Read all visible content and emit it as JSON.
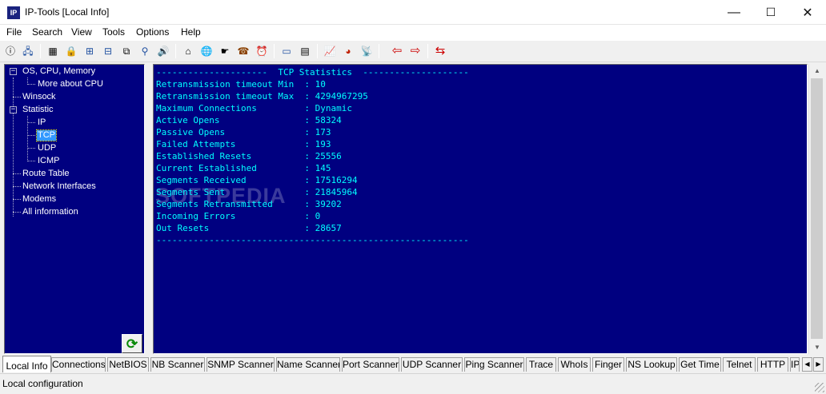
{
  "window": {
    "title": "IP-Tools [Local Info]",
    "icon_text": "IP",
    "controls": {
      "minimize": "—",
      "maximize": "☐",
      "close": "✕"
    }
  },
  "menu": [
    "File",
    "Search",
    "View",
    "Tools",
    "Options",
    "Help"
  ],
  "toolbar": {
    "buttons": [
      {
        "icon": "info-icon",
        "glyph": "ⓘ"
      },
      {
        "icon": "computers-icon",
        "glyph": "🖧"
      },
      {
        "icon": "table-icon",
        "glyph": "▦"
      },
      {
        "icon": "lock-icon",
        "glyph": "🔒"
      },
      {
        "icon": "network-tree-icon",
        "glyph": "⊞"
      },
      {
        "icon": "hierarchy-icon",
        "glyph": "⊟"
      },
      {
        "icon": "binoculars-icon",
        "glyph": "⧉"
      },
      {
        "icon": "ping-icon",
        "glyph": "⚲"
      },
      {
        "icon": "speaker-icon",
        "glyph": "🔊"
      },
      {
        "icon": "hub-icon",
        "glyph": "⌂"
      },
      {
        "icon": "globe-icon",
        "glyph": "🌐"
      },
      {
        "icon": "finger-icon",
        "glyph": "☛"
      },
      {
        "icon": "phone-icon",
        "glyph": "☎"
      },
      {
        "icon": "clock-icon",
        "glyph": "⏰"
      },
      {
        "icon": "telnet-icon",
        "glyph": "▭"
      },
      {
        "icon": "document-icon",
        "glyph": "▤"
      },
      {
        "icon": "chart-icon",
        "glyph": "📈"
      },
      {
        "icon": "pie-chart-icon",
        "glyph": "◕"
      },
      {
        "icon": "satellite-icon",
        "glyph": "📡"
      },
      {
        "icon": "arrow-left-icon",
        "glyph": "⇦"
      },
      {
        "icon": "arrow-right-icon",
        "glyph": "⇨"
      },
      {
        "icon": "exchange-icon",
        "glyph": "⇆"
      }
    ],
    "colors": {
      "arrows": "#cc0000",
      "exchange": "#cc0000"
    }
  },
  "tree": {
    "items": [
      {
        "label": "OS, CPU, Memory",
        "level": 0,
        "expander": "−"
      },
      {
        "label": "More about CPU",
        "level": 1
      },
      {
        "label": "Winsock",
        "level": 0
      },
      {
        "label": "Statistic",
        "level": 0,
        "expander": "−"
      },
      {
        "label": "IP",
        "level": 1
      },
      {
        "label": "TCP",
        "level": 1,
        "selected": true
      },
      {
        "label": "UDP",
        "level": 1
      },
      {
        "label": "ICMP",
        "level": 1
      },
      {
        "label": "Route Table",
        "level": 0
      },
      {
        "label": "Network Interfaces",
        "level": 0
      },
      {
        "label": "Modems",
        "level": 0
      },
      {
        "label": "All information",
        "level": 0
      }
    ]
  },
  "output": {
    "lines": [
      "---------------------  TCP Statistics  --------------------",
      "Retransmission timeout Min  : 10",
      "Retransmission timeout Max  : 4294967295",
      "Maximum Connections         : Dynamic",
      "Active Opens                : 58324",
      "Passive Opens               : 173",
      "Failed Attempts             : 193",
      "Established Resets          : 25556",
      "Current Established         : 145",
      "Segments Received           : 17516294",
      "Segments Sent               : 21845964",
      "Segments Retransmitted      : 39202",
      "Incoming Errors             : 0",
      "Out Resets                  : 28657",
      "-----------------------------------------------------------"
    ],
    "watermark": "SOFTPEDIA",
    "colors": {
      "background": "#000080",
      "text": "#00ffff"
    }
  },
  "tabs": [
    {
      "label": "Local Info",
      "active": true
    },
    {
      "label": "Connections"
    },
    {
      "label": "NetBIOS"
    },
    {
      "label": "NB Scanner"
    },
    {
      "label": "SNMP Scanner"
    },
    {
      "label": "Name Scanner"
    },
    {
      "label": "Port Scanner"
    },
    {
      "label": "UDP Scanner"
    },
    {
      "label": "Ping Scanner"
    },
    {
      "label": "Trace"
    },
    {
      "label": "WhoIs"
    },
    {
      "label": "Finger"
    },
    {
      "label": "NS Lookup"
    },
    {
      "label": "Get Time"
    },
    {
      "label": "Telnet"
    },
    {
      "label": "HTTP"
    },
    {
      "label": "IP"
    }
  ],
  "status": {
    "text": "Local configuration"
  },
  "icons": {
    "refresh": "refresh-icon",
    "refresh_glyph": "⟳"
  }
}
